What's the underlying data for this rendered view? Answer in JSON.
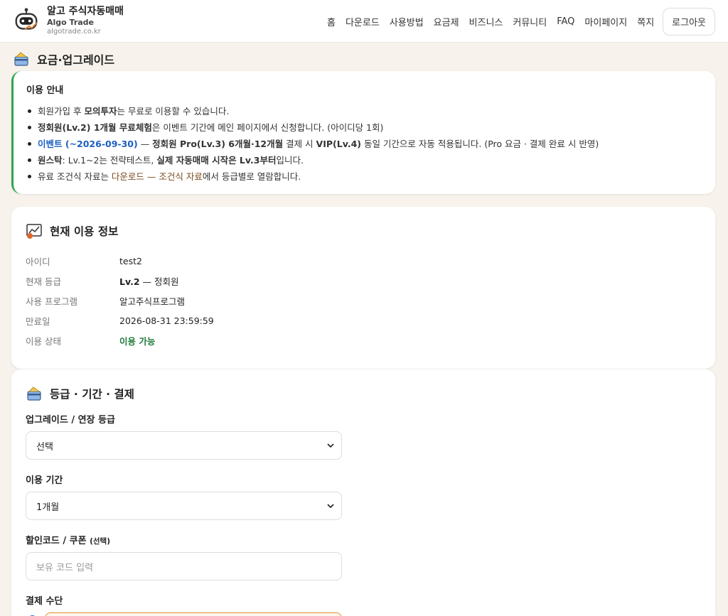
{
  "brand": {
    "title": "알고 주식자동매매",
    "subtitle": "Algo Trade",
    "url": "algotrade.co.kr"
  },
  "nav": {
    "items": [
      "홈",
      "다운로드",
      "사용방법",
      "요금제",
      "비즈니스",
      "커뮤니티",
      "FAQ",
      "마이페이지",
      "쪽지"
    ],
    "logout": "로그아웃"
  },
  "page": {
    "title": "요금·업그레이드"
  },
  "notice": {
    "title": "이용 안내",
    "l1a": "회원가입 후 ",
    "l1b": "모의투자",
    "l1c": "는 무료로 이용할 수 있습니다.",
    "l2a": "정회원(Lv.2) 1개월 무료체험",
    "l2b": "은 이벤트 기간에 메인 페이지에서 신청합니다. (아이디당 1회)",
    "l3a": "이벤트 (~2026-09-30)",
    "l3b": " — ",
    "l3c": "정회원 Pro(Lv.3) 6개월·12개월",
    "l3d": " 결제 시 ",
    "l3e": "VIP(Lv.4)",
    "l3f": " 동일 기간으로 자동 적용됩니다. (Pro 요금 · 결제 완료 시 반영)",
    "l4a": "원스탁",
    "l4b": ": Lv.1~2는 전략테스트, ",
    "l4c": "실제 자동매매 시작은 Lv.3부터",
    "l4d": "입니다.",
    "l5a": "유료 조건식 자료는 ",
    "l5b": "다운로드 — 조건식 자료",
    "l5c": "에서 등급별로 열람합니다."
  },
  "info": {
    "title": "현재 이용 정보",
    "rows": [
      {
        "k": "아이디",
        "v": "test2"
      },
      {
        "k": "현재 등급",
        "v1": "Lv.2",
        "v2": " — 정회원"
      },
      {
        "k": "사용 프로그램",
        "v": "알고주식프로그램"
      },
      {
        "k": "만료일",
        "v": "2026-08-31 23:59:59"
      },
      {
        "k": "이용 상태",
        "v": "이용 가능"
      }
    ]
  },
  "pay": {
    "title": "등급 · 기간 · 결제",
    "grade_label": "업그레이드 / 연장 등급",
    "grade_value": "선택",
    "period_label": "이용 기간",
    "period_value": "1개월",
    "coupon_label": "할인코드 / 쿠폰",
    "coupon_small": "(선택)",
    "coupon_placeholder": "보유 코드 입력",
    "method_label": "결제 수단"
  },
  "colors": {
    "accent_green": "#2ea44f",
    "link_blue": "#1d5fbf",
    "status_ok": "#1e7a3a",
    "pay_border": "#e08a2f"
  }
}
